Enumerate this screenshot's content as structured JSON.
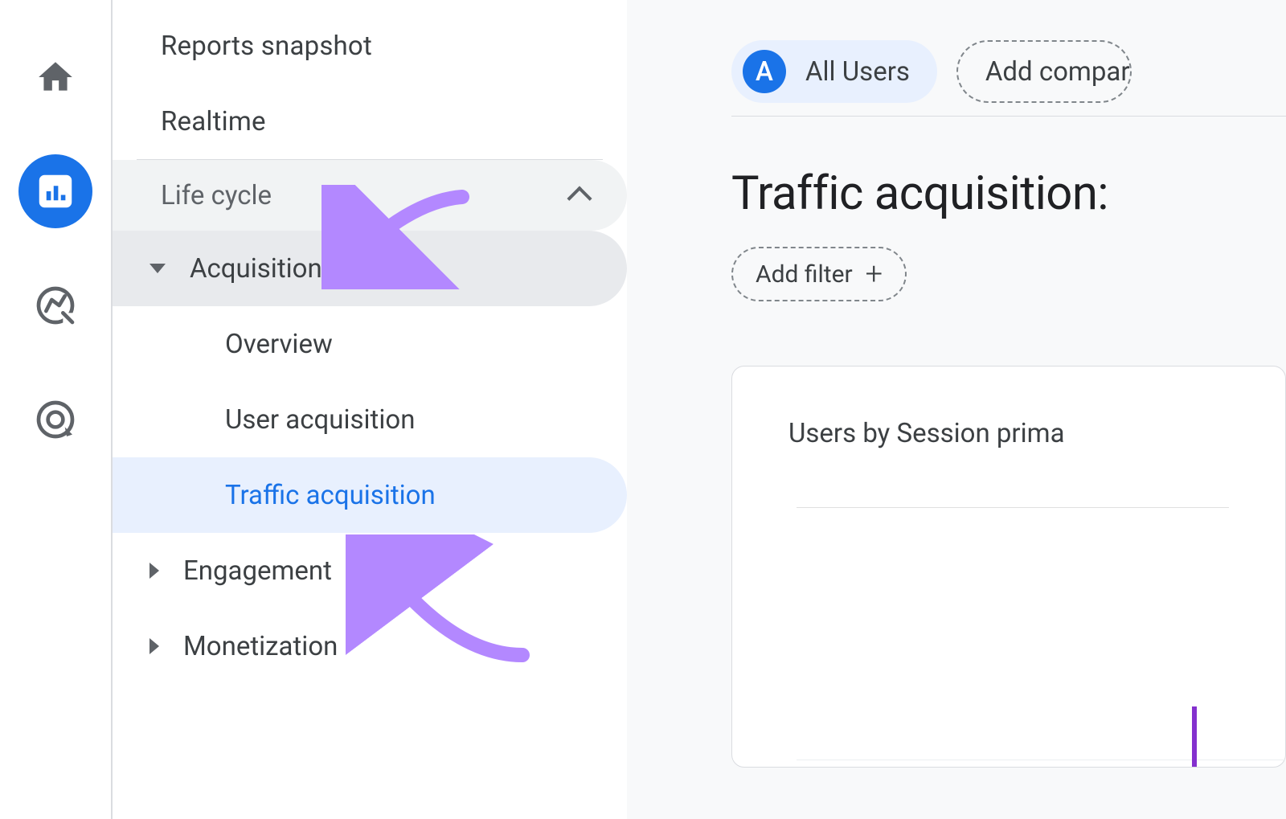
{
  "rail": {
    "items": [
      "home",
      "reports",
      "explore",
      "advertising"
    ]
  },
  "nav": {
    "snapshot": "Reports snapshot",
    "realtime": "Realtime",
    "section": "Life cycle",
    "acquisition": {
      "label": "Acquisition",
      "children": {
        "overview": "Overview",
        "user_acq": "User acquisition",
        "traffic_acq": "Traffic acquisition"
      }
    },
    "engagement": "Engagement",
    "monetization": "Monetization"
  },
  "content": {
    "chip_badge": "A",
    "chip_label": "All Users",
    "add_comparison": "Add compar",
    "title": "Traffic acquisition:",
    "add_filter": "Add filter",
    "card_title": "Users by Session prima"
  },
  "colors": {
    "primary": "#1a73e8",
    "annotation": "#b388ff"
  }
}
